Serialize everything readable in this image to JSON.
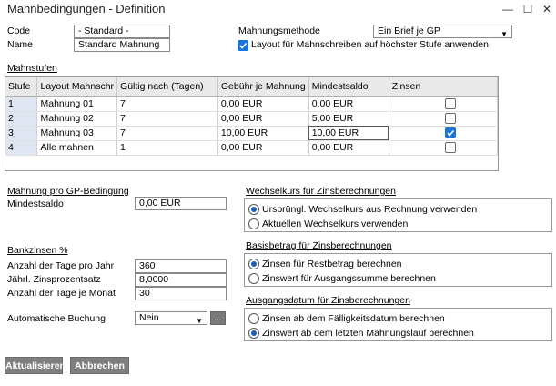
{
  "window": {
    "title": "Mahnbedingungen - Definition",
    "minimize": "—",
    "maximize": "☐",
    "close": "✕"
  },
  "header": {
    "code_label": "Code",
    "code_value": "- Standard -",
    "name_label": "Name",
    "name_value": "Standard Mahnung",
    "method_label": "Mahnungsmethode",
    "method_value": "Ein Brief je GP",
    "layout_checkbox_label": "Layout für Mahnschreiben auf höchster Stufe anwenden",
    "layout_checked": true
  },
  "levels": {
    "section_title": "Mahnstufen",
    "columns": [
      "Stufe",
      "Layout Mahnschr",
      "Gültig nach (Tagen)",
      "Gebühr je Mahnung",
      "Mindestsaldo",
      "Zinsen"
    ],
    "rows": [
      {
        "stufe": "1",
        "layout": "Mahnung 01",
        "days": "7",
        "fee": "0,00 EUR",
        "min": "0,00 EUR",
        "interest": false
      },
      {
        "stufe": "2",
        "layout": "Mahnung 02",
        "days": "7",
        "fee": "0,00 EUR",
        "min": "5,00 EUR",
        "interest": false
      },
      {
        "stufe": "3",
        "layout": "Mahnung 03",
        "days": "7",
        "fee": "10,00 EUR",
        "min": "10,00 EUR",
        "interest": true
      },
      {
        "stufe": "4",
        "layout": "Alle mahnen",
        "days": "1",
        "fee": "0,00 EUR",
        "min": "0,00 EUR",
        "interest": false
      }
    ]
  },
  "gp_condition": {
    "title": "Mahnung pro GP-Bedingung",
    "min_label": "Mindestsaldo",
    "min_value": "0,00 EUR"
  },
  "interest": {
    "title": "Bankzinsen %",
    "days_year_label": "Anzahl der Tage pro Jahr",
    "days_year_value": "360",
    "rate_label": "Jährl. Zinsprozentsatz",
    "rate_value": "8,0000",
    "days_month_label": "Anzahl der Tage je Monat",
    "days_month_value": "30"
  },
  "auto_booking": {
    "label": "Automatische Buchung",
    "value": "Nein",
    "more": "..."
  },
  "exchange": {
    "title": "Wechselkurs für Zinsberechnungen",
    "options": [
      "Ursprüngl. Wechselkurs aus Rechnung verwenden",
      "Aktuellen Wechselkurs verwenden"
    ],
    "selected": 0
  },
  "base_amount": {
    "title": "Basisbetrag für Zinsberechnungen",
    "options": [
      "Zinsen für Restbetrag berechnen",
      "Zinswert für Ausgangssumme berechnen"
    ],
    "selected": 0
  },
  "start_date": {
    "title": "Ausgangsdatum für Zinsberechnungen",
    "options": [
      "Zinsen ab dem Fälligkeitsdatum berechnen",
      "Zinswert ab dem letzten Mahnungslauf berechnen"
    ],
    "selected": 1
  },
  "buttons": {
    "update": "Aktualisieren",
    "cancel": "Abbrechen"
  }
}
